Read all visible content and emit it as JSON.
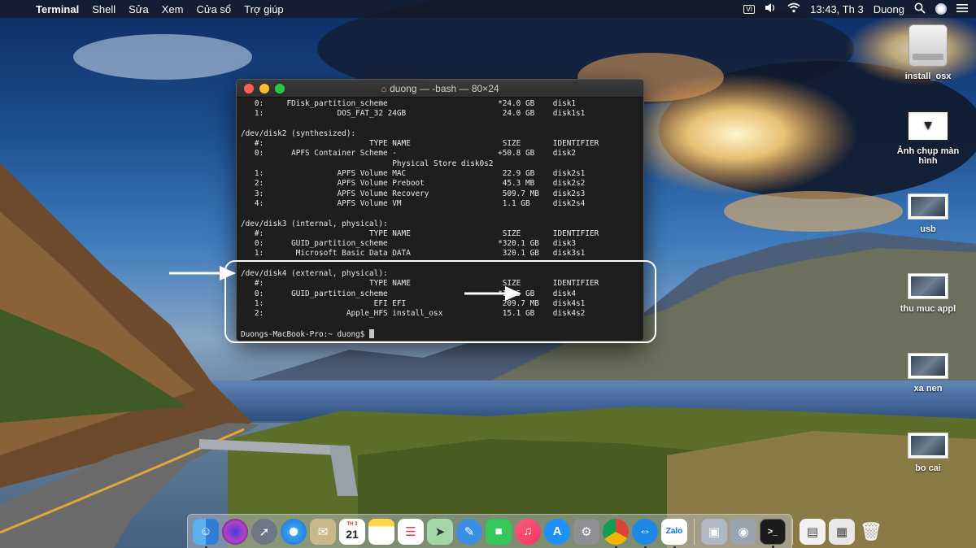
{
  "menubar": {
    "app_name": "Terminal",
    "items": [
      "Shell",
      "Sửa",
      "Xem",
      "Cửa sổ",
      "Trợ giúp"
    ],
    "keyboard_badge": "VI",
    "clock": "13:43, Th 3",
    "user": "Duong"
  },
  "terminal": {
    "title": "duong — -bash — 80×24",
    "lines": [
      "   0:     FDisk_partition_scheme                        *24.0 GB    disk1",
      "   1:                DOS_FAT_32 24GB                     24.0 GB    disk1s1",
      "",
      "/dev/disk2 (synthesized):",
      "   #:                       TYPE NAME                    SIZE       IDENTIFIER",
      "   0:      APFS Container Scheme -                      +50.8 GB    disk2",
      "                                 Physical Store disk0s2",
      "   1:                APFS Volume MAC                     22.9 GB    disk2s1",
      "   2:                APFS Volume Preboot                 45.3 MB    disk2s2",
      "   3:                APFS Volume Recovery                509.7 MB   disk2s3",
      "   4:                APFS Volume VM                      1.1 GB     disk2s4",
      "",
      "/dev/disk3 (internal, physical):",
      "   #:                       TYPE NAME                    SIZE       IDENTIFIER",
      "   0:      GUID_partition_scheme                        *320.1 GB   disk3",
      "   1:       Microsoft Basic Data DATA                    320.1 GB   disk3s1",
      "",
      "/dev/disk4 (external, physical):",
      "   #:                       TYPE NAME                    SIZE       IDENTIFIER",
      "   0:      GUID_partition_scheme                        *15.5 GB    disk4",
      "   1:                        EFI EFI                     209.7 MB   disk4s1",
      "   2:                  Apple_HFS install_osx             15.1 GB    disk4s2",
      ""
    ],
    "prompt": "Duongs-MacBook-Pro:~ duong$ "
  },
  "desktop_icons": [
    {
      "label": "install_osx",
      "kind": "drive"
    },
    {
      "label": "Ảnh chụp màn hình",
      "kind": "screenshots"
    },
    {
      "label": "usb",
      "kind": "folder"
    },
    {
      "label": "thu muc appl",
      "kind": "folder"
    },
    {
      "label": "xa nen",
      "kind": "folder"
    },
    {
      "label": "bo cai",
      "kind": "folder"
    }
  ],
  "dock": {
    "calendar_day": "21",
    "calendar_month": "TH 3",
    "zalo_label": "Zalo"
  },
  "colors": {
    "annotation": "#ffffff",
    "terminal_bg": "#1e1e1e",
    "close": "#fe5f57",
    "minimize": "#febc2e",
    "maximize": "#28c840"
  }
}
